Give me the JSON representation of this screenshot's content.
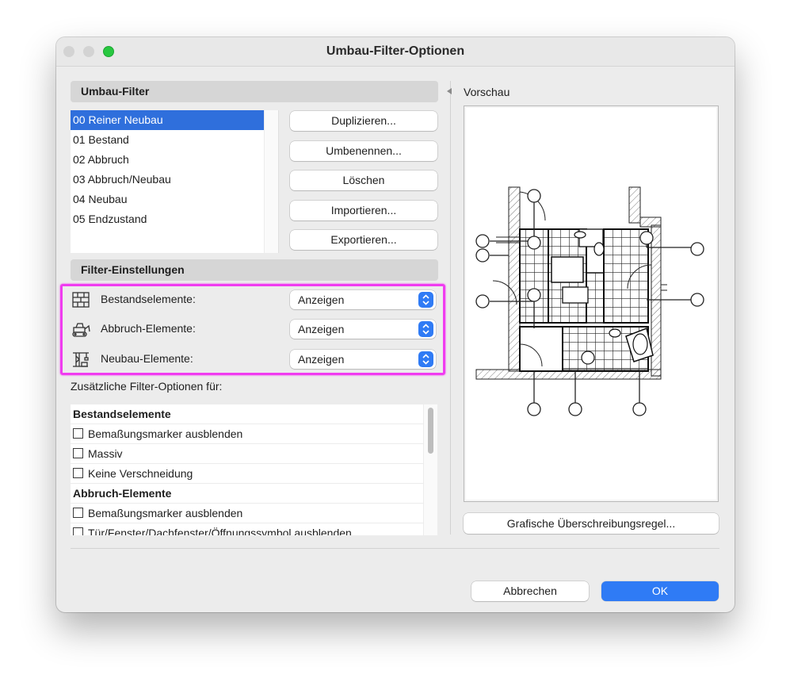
{
  "window": {
    "title": "Umbau-Filter-Optionen"
  },
  "filters_section": {
    "header": "Umbau-Filter",
    "items": [
      {
        "label": "00 Reiner Neubau",
        "selected": true
      },
      {
        "label": "01 Bestand"
      },
      {
        "label": "02 Abbruch"
      },
      {
        "label": "03 Abbruch/Neubau"
      },
      {
        "label": "04 Neubau"
      },
      {
        "label": "05 Endzustand"
      }
    ],
    "buttons": {
      "duplicate": "Duplizieren...",
      "rename": "Umbenennen...",
      "delete": "Löschen",
      "import": "Importieren...",
      "export": "Exportieren..."
    }
  },
  "settings_section": {
    "header": "Filter-Einstellungen",
    "rows": [
      {
        "label": "Bestandselemente:",
        "value": "Anzeigen",
        "icon": "brick-wall-icon"
      },
      {
        "label": "Abbruch-Elemente:",
        "value": "Anzeigen",
        "icon": "demolition-icon"
      },
      {
        "label": "Neubau-Elemente:",
        "value": "Anzeigen",
        "icon": "crane-icon"
      }
    ],
    "highlight_color": "#f03cf0"
  },
  "additional": {
    "label": "Zusätzliche Filter-Optionen für:",
    "groups": [
      {
        "title": "Bestandselemente",
        "options": [
          {
            "label": "Bemaßungsmarker ausblenden",
            "checked": false
          },
          {
            "label": "Massiv",
            "checked": false
          },
          {
            "label": "Keine Verschneidung",
            "checked": false
          }
        ]
      },
      {
        "title": "Abbruch-Elemente",
        "options": [
          {
            "label": "Bemaßungsmarker ausblenden",
            "checked": false
          },
          {
            "label": "Tür/Fenster/Dachfenster/Öffnungssymbol ausblenden",
            "checked": false
          }
        ]
      }
    ]
  },
  "preview": {
    "label": "Vorschau",
    "override_button": "Grafische Überschreibungsregel..."
  },
  "footer": {
    "cancel": "Abbrechen",
    "ok": "OK",
    "accent": "#2f7bf5"
  }
}
